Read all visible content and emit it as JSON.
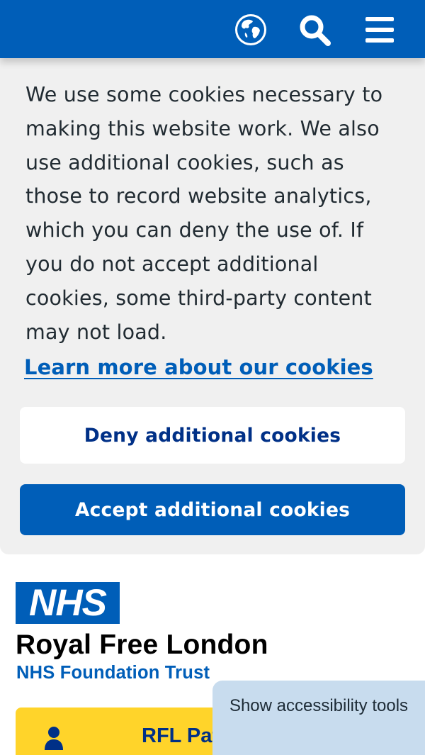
{
  "header": {
    "icons": [
      "globe-icon",
      "search-icon",
      "menu-icon"
    ],
    "background": "#005eb8"
  },
  "cookie_banner": {
    "message": "We use some cookies necessary to making this website work. We also use additional cookies, such as those to record website analytics, which you can deny the use of. If you do not accept additional cookies, some third-party content may not load.",
    "link_label": "Learn more about our cookies",
    "deny_label": "Deny additional cookies",
    "accept_label": "Accept additional cookies"
  },
  "brand": {
    "logo_text": "NHS",
    "org_name": "Royal Free London",
    "org_subtitle": "NHS Foundation Trust"
  },
  "patient_button": {
    "label": "RFL Pat",
    "color": "#ffd42a"
  },
  "accessibility": {
    "label": "Show accessibility tools"
  }
}
